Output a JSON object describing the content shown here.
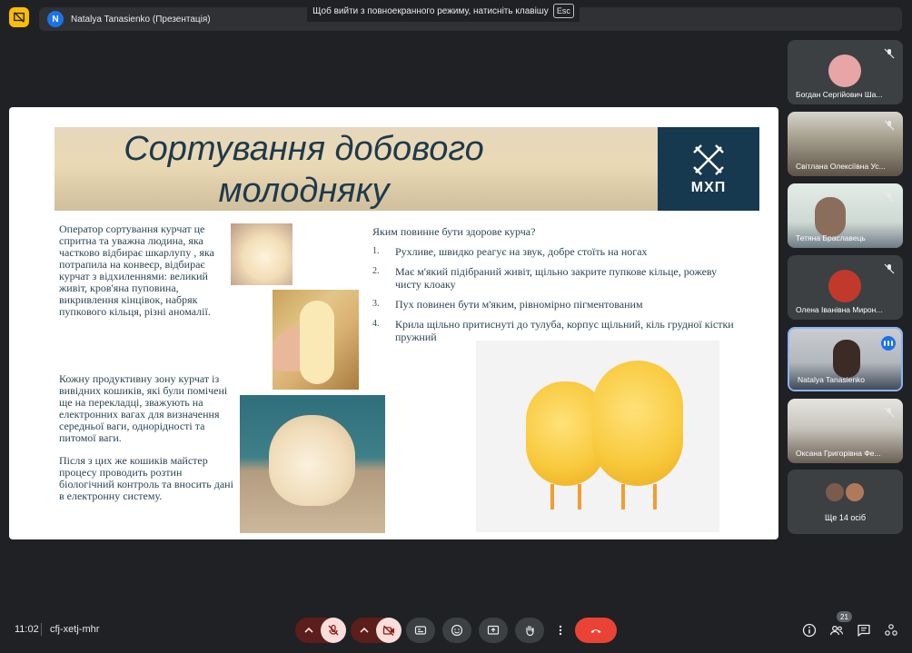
{
  "topbar": {
    "presenter_initial": "N",
    "presenter_title": "Natalya Tanasienko (Презентація)",
    "esc_hint": "Щоб вийти з повноекранного режиму, натисніть клавішу",
    "esc_key": "Esc"
  },
  "slide": {
    "title_line1": "Сортування добового",
    "title_line2": "молодняку",
    "logo_text": "МХП",
    "paragraph1": "Оператор сортування курчат це спритна та уважна людина, яка частково відбирає шкарлупу , яка потрапила на конвеєр, відбирає курчат з відхиленнями: великий живіт, кров'яна пуповина, викривлення кінцівок, набряк пупкового кільця, різні аномалії.",
    "paragraph2": "Кожну продуктивну зону курчат із вивідних кошиків, які були помічені ще на перекладці, зважують на електронних вагах для визначення середньої ваги, однорідності та питомої ваги.",
    "paragraph3": "Після з цих же кошиків майстер процесу проводить розтин біологічний контроль та вносить дані в електронну систему.",
    "question": "Яким повинне бути здорове курча?",
    "criteria": [
      {
        "num": "1.",
        "text": "Рухливе, швидко реагує на звук, добре стоїть на ногах"
      },
      {
        "num": "2.",
        "text": "Має м'який підібраний живіт, щільно закрите пупкове кільце, рожеву чисту клоаку"
      },
      {
        "num": "3.",
        "text": "Пух повинен бути м'яким, рівномірно пігментованим"
      },
      {
        "num": "4.",
        "text": "Крила щільно притиснуті до тулуба, корпус щільний, кіль грудної кістки пружний"
      }
    ]
  },
  "participants": [
    {
      "name": "Богдан Сергійович Ша..."
    },
    {
      "name": "Світлана Олексіївна Ус..."
    },
    {
      "name": "Тетяна Браславець"
    },
    {
      "name": "Олена Іванівна Мирон..."
    },
    {
      "name": "Natalya Tanasienko"
    },
    {
      "name": "Оксана Григорівна Фе..."
    }
  ],
  "more_participants": "Ще 14 осіб",
  "bottombar": {
    "time": "11:02",
    "meeting_code": "cfj-xetj-mhr",
    "participants_count": "21"
  },
  "colors": {
    "background": "#202124",
    "accent": "#8ab4f8",
    "end_call": "#ea4335",
    "present_chip": "#fbbc04"
  }
}
